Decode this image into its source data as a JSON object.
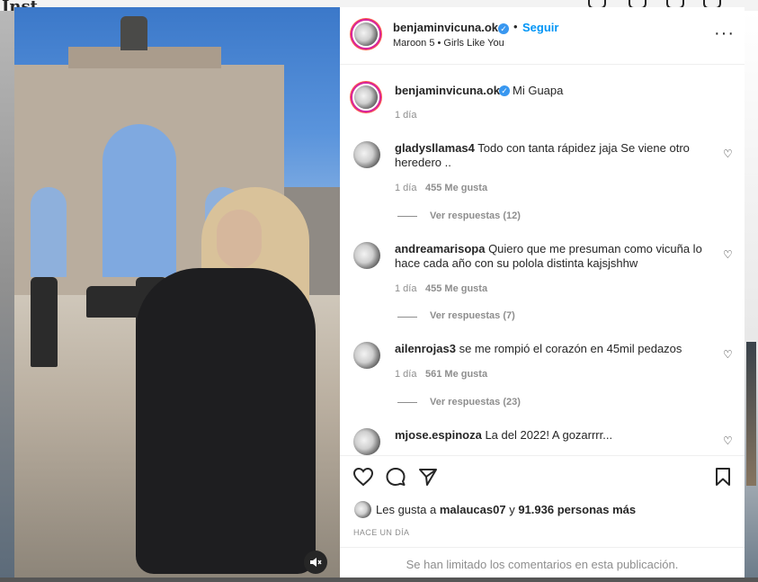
{
  "background_page": {
    "logo": "Inst"
  },
  "post": {
    "author": "benjaminvicuna.ok",
    "follow_label": "Seguir",
    "audio": "Maroon 5 • Girls Like You",
    "more_icon": "more-horizontal-icon",
    "caption": "Mi Guapa",
    "caption_time": "1 día"
  },
  "comments": [
    {
      "user": "gladysllamas4",
      "text": "Todo con tanta rápidez jaja Se viene otro heredero ..",
      "time": "1 día",
      "likes": "455 Me gusta",
      "replies": "Ver respuestas (12)"
    },
    {
      "user": "andreamarisopa",
      "text": "Quiero que me presuman como vicuña lo hace cada año con su polola distinta kajsjshhw",
      "time": "1 día",
      "likes": "455 Me gusta",
      "replies": "Ver respuestas (7)"
    },
    {
      "user": "ailenrojas3",
      "text": "se me rompió el corazón en 45mil pedazos",
      "time": "1 día",
      "likes": "561 Me gusta",
      "replies": "Ver respuestas (23)"
    },
    {
      "user": "mjose.espinoza",
      "text": "La del 2022! A gozarrrr..."
    }
  ],
  "likes_summary": {
    "prefix": "Les gusta a",
    "user": "malaucas07",
    "middle": "y",
    "count": "91.936 personas más"
  },
  "post_time": "HACE UN DÍA",
  "comments_limited": "Se han limitado los comentarios en esta publicación.",
  "icons": {
    "like": "heart-icon",
    "comment": "comment-icon",
    "share": "share-icon",
    "save": "bookmark-icon",
    "mute": "muted-speaker-icon"
  },
  "colors": {
    "follow_blue": "#0095f6",
    "verified_blue": "#3897f0",
    "secondary_text": "#8e8e8e"
  }
}
